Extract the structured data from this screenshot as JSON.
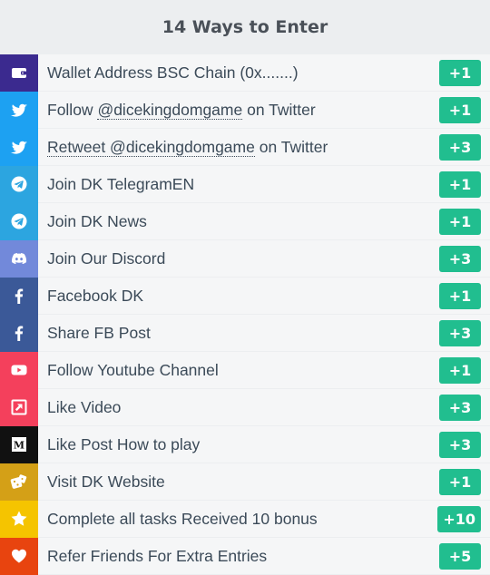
{
  "header": {
    "title": "14 Ways to Enter"
  },
  "entries": [
    {
      "icon": "wallet-icon",
      "color": "#3b2a8f",
      "pre": "Wallet Address BSC Chain (0x.......)",
      "link": "",
      "post": "",
      "points": "+1"
    },
    {
      "icon": "twitter-icon",
      "color": "#1da1f2",
      "pre": "Follow ",
      "link": "@dicekingdomgame",
      "post": " on Twitter",
      "points": "+1"
    },
    {
      "icon": "twitter-icon",
      "color": "#1da1f2",
      "pre": "",
      "link": "Retweet @dicekingdomgame",
      "post": " on Twitter",
      "points": "+3"
    },
    {
      "icon": "telegram-icon",
      "color": "#2ca5e0",
      "pre": "Join DK TelegramEN",
      "link": "",
      "post": "",
      "points": "+1"
    },
    {
      "icon": "telegram-icon",
      "color": "#2ca5e0",
      "pre": "Join DK News",
      "link": "",
      "post": "",
      "points": "+1"
    },
    {
      "icon": "discord-icon",
      "color": "#7289da",
      "pre": "Join Our Discord",
      "link": "",
      "post": "",
      "points": "+3"
    },
    {
      "icon": "facebook-icon",
      "color": "#3b5998",
      "pre": "Facebook DK",
      "link": "",
      "post": "",
      "points": "+1"
    },
    {
      "icon": "facebook-icon",
      "color": "#3b5998",
      "pre": "Share FB Post",
      "link": "",
      "post": "",
      "points": "+3"
    },
    {
      "icon": "youtube-icon",
      "color": "#f4405c",
      "pre": "Follow Youtube Channel",
      "link": "",
      "post": "",
      "points": "+1"
    },
    {
      "icon": "external-link-icon",
      "color": "#f4405c",
      "pre": "Like Video",
      "link": "",
      "post": "",
      "points": "+3"
    },
    {
      "icon": "medium-icon",
      "color": "#111111",
      "pre": "Like Post How to play",
      "link": "",
      "post": "",
      "points": "+3"
    },
    {
      "icon": "dice-icon",
      "color": "#d4a017",
      "pre": "Visit DK Website",
      "link": "",
      "post": "",
      "points": "+1"
    },
    {
      "icon": "star-icon",
      "color": "#f5c400",
      "pre": "Complete all tasks Received 10 bonus",
      "link": "",
      "post": "",
      "points": "+10"
    },
    {
      "icon": "heart-icon",
      "color": "#e8440f",
      "pre": "Refer Friends For Extra Entries",
      "link": "",
      "post": "",
      "points": "+5"
    }
  ]
}
